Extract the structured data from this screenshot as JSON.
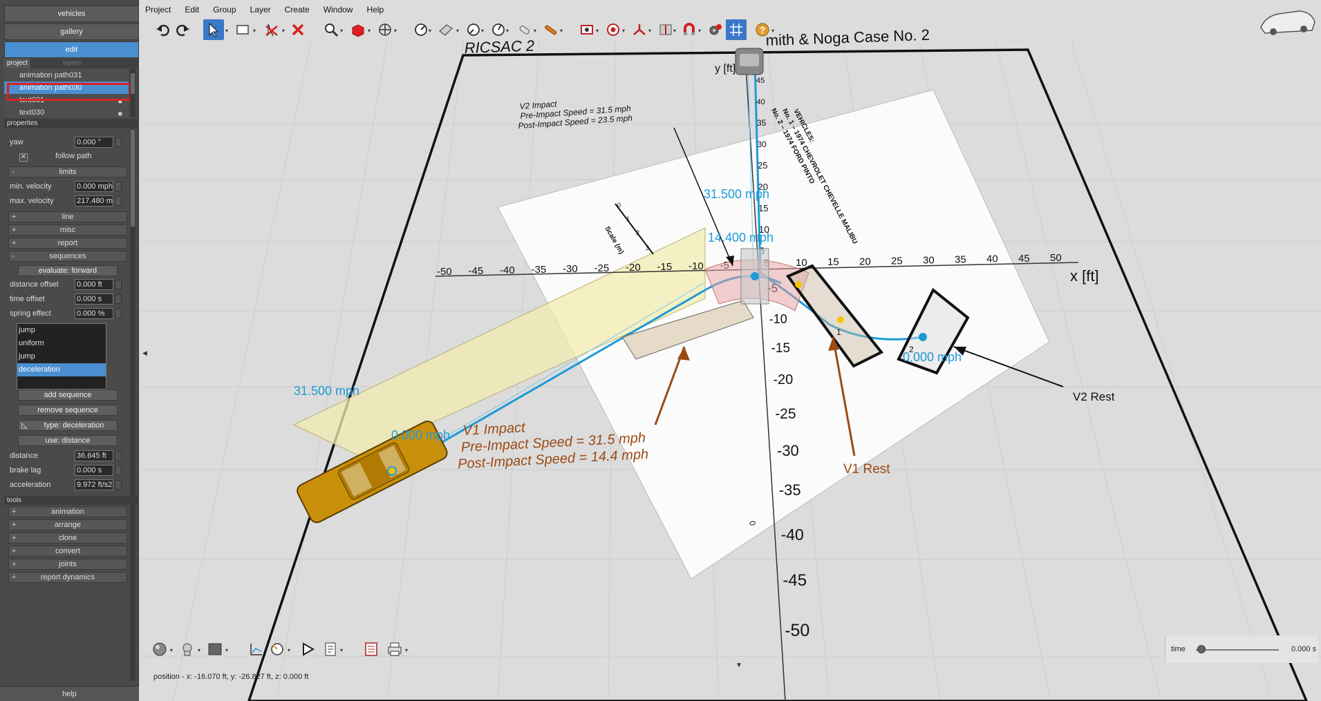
{
  "left_panel": {
    "top_buttons": [
      "vehicles",
      "gallery",
      "edit"
    ],
    "tabs": {
      "project": "project",
      "layers": "layers"
    },
    "layers": [
      "animation path031",
      "animation path030",
      "text031",
      "text030"
    ],
    "sections": {
      "properties": "properties",
      "tools": "tools"
    },
    "props_top": [
      {
        "label": "yaw",
        "value": "0.000 °"
      }
    ],
    "follow_path": "follow path",
    "limits": "limits",
    "limits_rows": [
      {
        "label": "min. velocity",
        "value": "0.000 mph"
      },
      {
        "label": "max. velocity",
        "value": "217.480 m"
      }
    ],
    "collapsibles": [
      "line",
      "misc",
      "report",
      "sequences"
    ],
    "evaluate": "evaluate: forward",
    "seq_rows": [
      {
        "label": "distance offset",
        "value": "0.000 ft"
      },
      {
        "label": "time offset",
        "value": "0.000 s"
      },
      {
        "label": "spring effect",
        "value": "0.000 %"
      }
    ],
    "sequence_list": [
      "jump",
      "uniform",
      "jump",
      "deceleration"
    ],
    "seq_buttons": {
      "add": "add sequence",
      "remove": "remove sequence",
      "type": "type: deceleration",
      "use": "use: distance"
    },
    "motion_rows": [
      {
        "label": "distance",
        "value": "36.645 ft"
      },
      {
        "label": "brake lag",
        "value": "0.000 s"
      },
      {
        "label": "acceleration",
        "value": "9.972 ft/s2"
      }
    ],
    "tools": [
      "animation",
      "arrange",
      "clone",
      "convert",
      "joints",
      "report dynamics"
    ],
    "help": "help"
  },
  "menu": [
    "Project",
    "Edit",
    "Group",
    "Layer",
    "Create",
    "Window",
    "Help"
  ],
  "toolbar_icons": [
    "undo-icon",
    "redo-icon",
    "select-arrow-icon",
    "rectangle-select-icon",
    "unselect-icon",
    "delete-x-icon",
    "zoom-icon",
    "cube-icon",
    "move-icon",
    "measure-icon",
    "plane-icon",
    "angle-icon",
    "angle2-icon",
    "light-icon",
    "pencil-icon",
    "camera-icon",
    "target-icon",
    "axes-icon",
    "split-icon",
    "magnet-icon",
    "gear-settings-icon",
    "grid-icon",
    "help-icon"
  ],
  "bottom_icons": [
    "sphere-icon",
    "head-icon",
    "square-color-icon",
    "graph-icon",
    "ruler-icon",
    "play-icon",
    "report-icon",
    "document-icon",
    "print-icon"
  ],
  "status": "position - x: -16.070 ft, y: -26.827 ft, z: 0.000 ft",
  "time": {
    "label": "time",
    "value": "0.000 s"
  },
  "scene": {
    "title_left": "RICSAC 2",
    "title_right": "mith & Noga Case No. 2",
    "y_axis": "y [ft]",
    "x_axis": "x [ft]",
    "x_ticks": [
      "-50",
      "-45",
      "-40",
      "-35",
      "-30",
      "-25",
      "-20",
      "-15",
      "-10",
      "-5",
      "5",
      "10",
      "15",
      "20",
      "25",
      "30",
      "35",
      "40",
      "45",
      "50"
    ],
    "y_ticks_pos": [
      "45",
      "40",
      "35",
      "30",
      "25",
      "20",
      "15",
      "10",
      "5"
    ],
    "y_ticks_neg": [
      "-5",
      "-10",
      "-15",
      "-20",
      "-25",
      "-30",
      "-35",
      "-40",
      "-45",
      "-50"
    ],
    "speed_labels": [
      "31.500 mph",
      "14.400 mph",
      "31.500 mph",
      "0.000 mph",
      "0.000 mph"
    ],
    "v2_impact": [
      "V2 Impact",
      "Pre-Impact Speed = 31.5 mph",
      "Post-Impact Speed = 23.5 mph"
    ],
    "v1_impact": [
      "V1 Impact",
      "Pre-Impact Speed = 31.5 mph",
      "Post-Impact Speed = 14.4 mph"
    ],
    "v1_rest": "V1 Rest",
    "v2_rest": "V2 Rest",
    "vehicles_note": [
      "VEHICLES:",
      "No. 1 – 1974 CHEVROLET CHEVELLE MALIBU",
      "No. 2 – 1974 FORD PINTO"
    ],
    "scale_label": "Scale (m)",
    "scale_ticks": [
      "0",
      "1",
      "2",
      "3"
    ],
    "zero_mark": "0",
    "car_numbers": [
      "1",
      "2"
    ]
  }
}
